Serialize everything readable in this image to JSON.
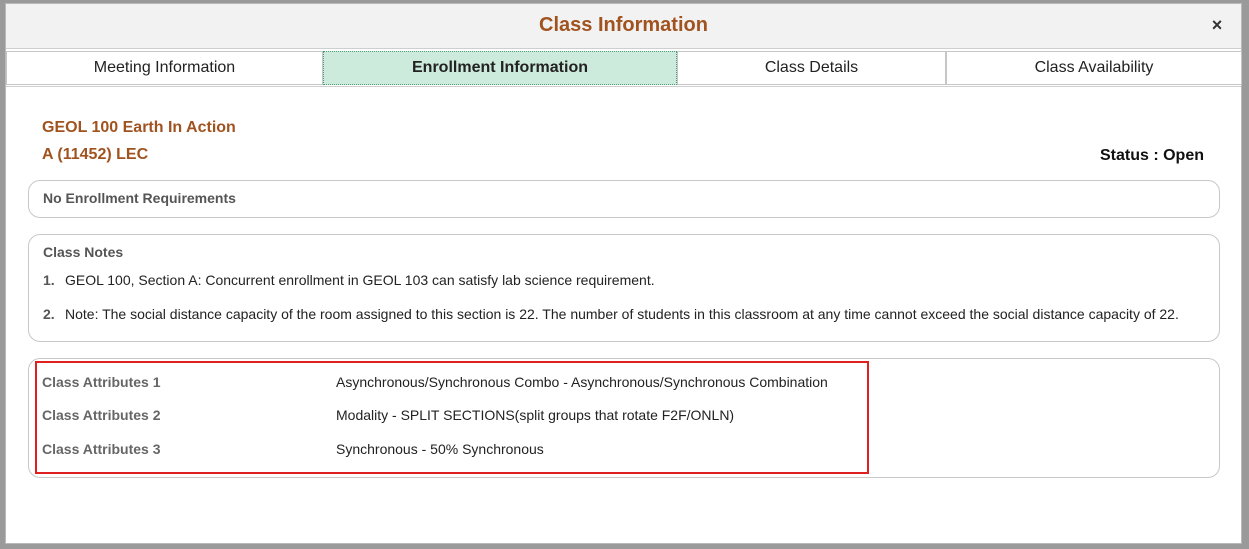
{
  "modal": {
    "title": "Class Information",
    "close_label": "×"
  },
  "tabs": [
    {
      "label": "Meeting Information",
      "active": false
    },
    {
      "label": "Enrollment Information",
      "active": true
    },
    {
      "label": "Class Details",
      "active": false
    },
    {
      "label": "Class Availability",
      "active": false
    }
  ],
  "course": {
    "title": "GEOL 100 Earth In Action",
    "section": "A (11452) LEC",
    "status": "Status : Open"
  },
  "requirements": {
    "text": "No Enrollment Requirements"
  },
  "notes": {
    "heading": "Class Notes",
    "items": [
      {
        "num": "1.",
        "text": "GEOL 100, Section A: Concurrent enrollment in GEOL 103 can satisfy lab science requirement."
      },
      {
        "num": "2.",
        "text": "Note: The social distance capacity of the room assigned to this section is 22.  The number of students in this classroom at any time cannot exceed the social distance capacity of 22."
      }
    ]
  },
  "attributes": [
    {
      "label": "Class Attributes 1",
      "value": "Asynchronous/Synchronous Combo - Asynchronous/Synchronous Combination"
    },
    {
      "label": "Class Attributes 2",
      "value": "Modality - SPLIT SECTIONS(split groups that rotate F2F/ONLN)"
    },
    {
      "label": "Class Attributes 3",
      "value": "Synchronous - 50% Synchronous"
    }
  ],
  "colors": {
    "accent": "#a0531f",
    "active_tab": "#cdebdc",
    "highlight": "#e02020"
  }
}
